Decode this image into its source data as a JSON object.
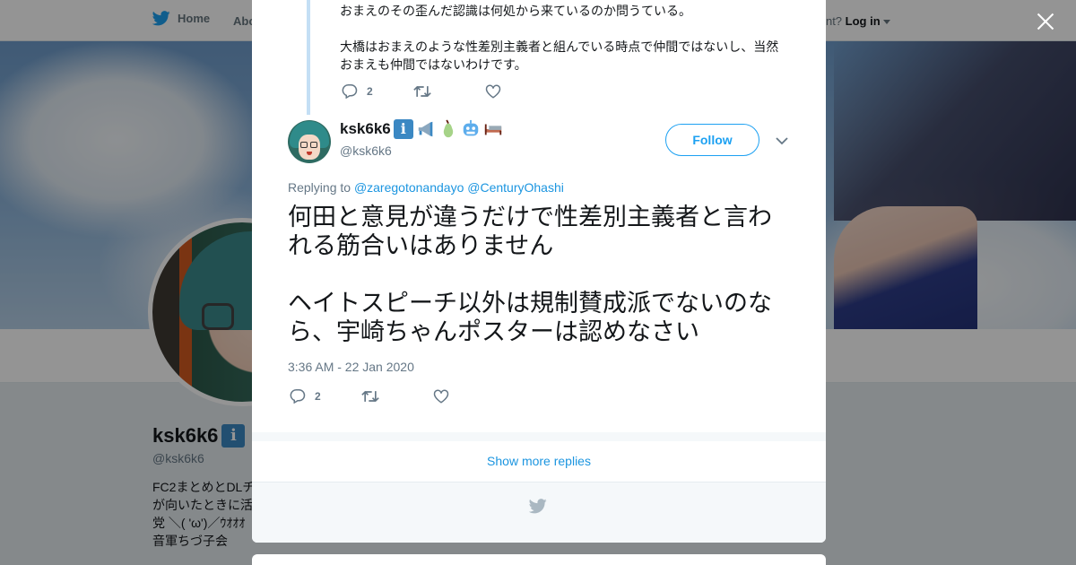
{
  "topnav": {
    "home_label": "Home",
    "about_label": "Abo",
    "account_prompt": "count?",
    "login_label": "Log in"
  },
  "background_profile": {
    "name": "ksk6k6",
    "handle": "@ksk6k6",
    "bio": "FC2まとめとDLチ\nが向いたときに活\n党 ＼( 'ω')／ｳｵｵｵ\n音軍ちづ子会"
  },
  "modal": {
    "previous_tweet": {
      "paragraphs": [
        "おまえのその歪んだ認識は何処から来ているのか問うている。",
        "大橋はおまえのような性差別主義者と組んでいる時点で仲間ではないし、当然おまえも仲間ではないわけです。"
      ],
      "reply_count": "2"
    },
    "tweet": {
      "author_name": "ksk6k6",
      "author_handle": "@ksk6k6",
      "name_emojis": [
        "info-emoji",
        "megaphone-emoji",
        "pear-emoji",
        "robot-face-emoji",
        "bed-emoji"
      ],
      "follow_label": "Follow",
      "replying_prefix": "Replying to",
      "reply_mentions": [
        "@zaregotonandayo",
        "@CenturyOhashi"
      ],
      "paragraphs": [
        "何田と意見が違うだけで性差別主義者と言われる筋合いはありません",
        "ヘイトスピーチ以外は規制賛成派でないのなら、宇崎ちゃんポスターは認めなさい"
      ],
      "timestamp": "3:36 AM - 22 Jan 2020",
      "reply_count": "2"
    },
    "show_more_label": "Show more replies"
  },
  "colors": {
    "twitter_blue": "#1da1f2",
    "link_blue": "#1b95e0",
    "muted_text": "#657786",
    "thread_line": "#c4dff5"
  }
}
